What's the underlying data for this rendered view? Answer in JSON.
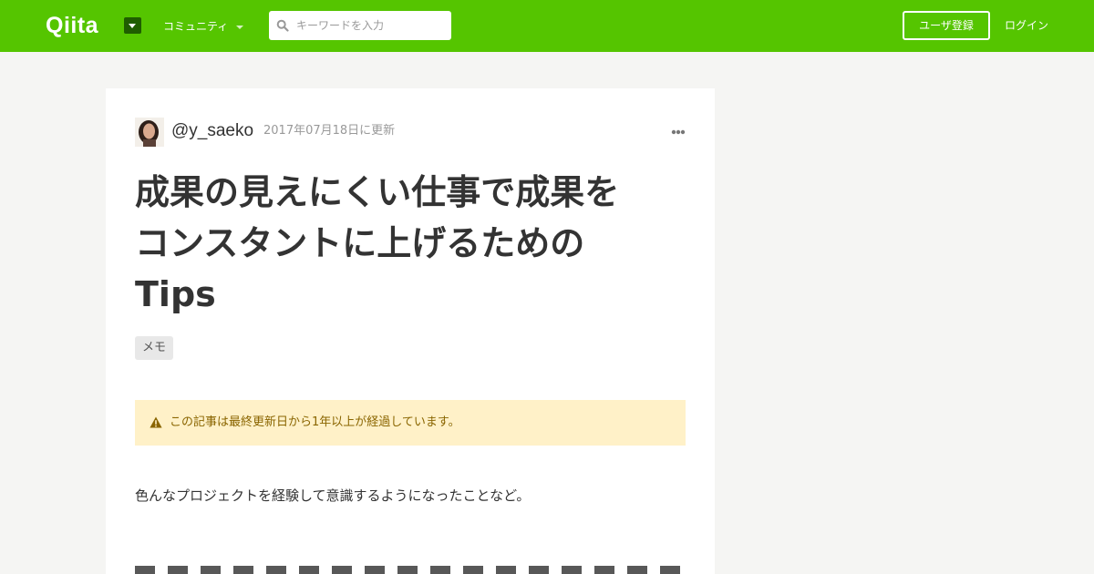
{
  "header": {
    "logo": "Qiita",
    "community_label": "コミュニティ",
    "search": {
      "placeholder": "キーワードを入力",
      "value": ""
    },
    "signup_label": "ユーザ登録",
    "login_label": "ログイン"
  },
  "article": {
    "username": "@y_saeko",
    "updated": "2017年07月18日に更新",
    "title_lines": [
      "成果の見えにくい仕事で成果を",
      "コンスタントに上げるための",
      "Tips"
    ],
    "tags": [
      "メモ"
    ],
    "notice": "この記事は最終更新日から1年以上が経過しています。",
    "intro": "色んなプロジェクトを経験して意識するようになったことなど。"
  },
  "colors": {
    "brand": "#55c500",
    "background": "#f5f5f3",
    "notice_bg": "#fff1c8",
    "notice_text": "#8a6500"
  },
  "icons": [
    "logo-menu-icon",
    "chevron-down-icon",
    "search-icon",
    "avatar",
    "more-icon",
    "warning-icon"
  ]
}
